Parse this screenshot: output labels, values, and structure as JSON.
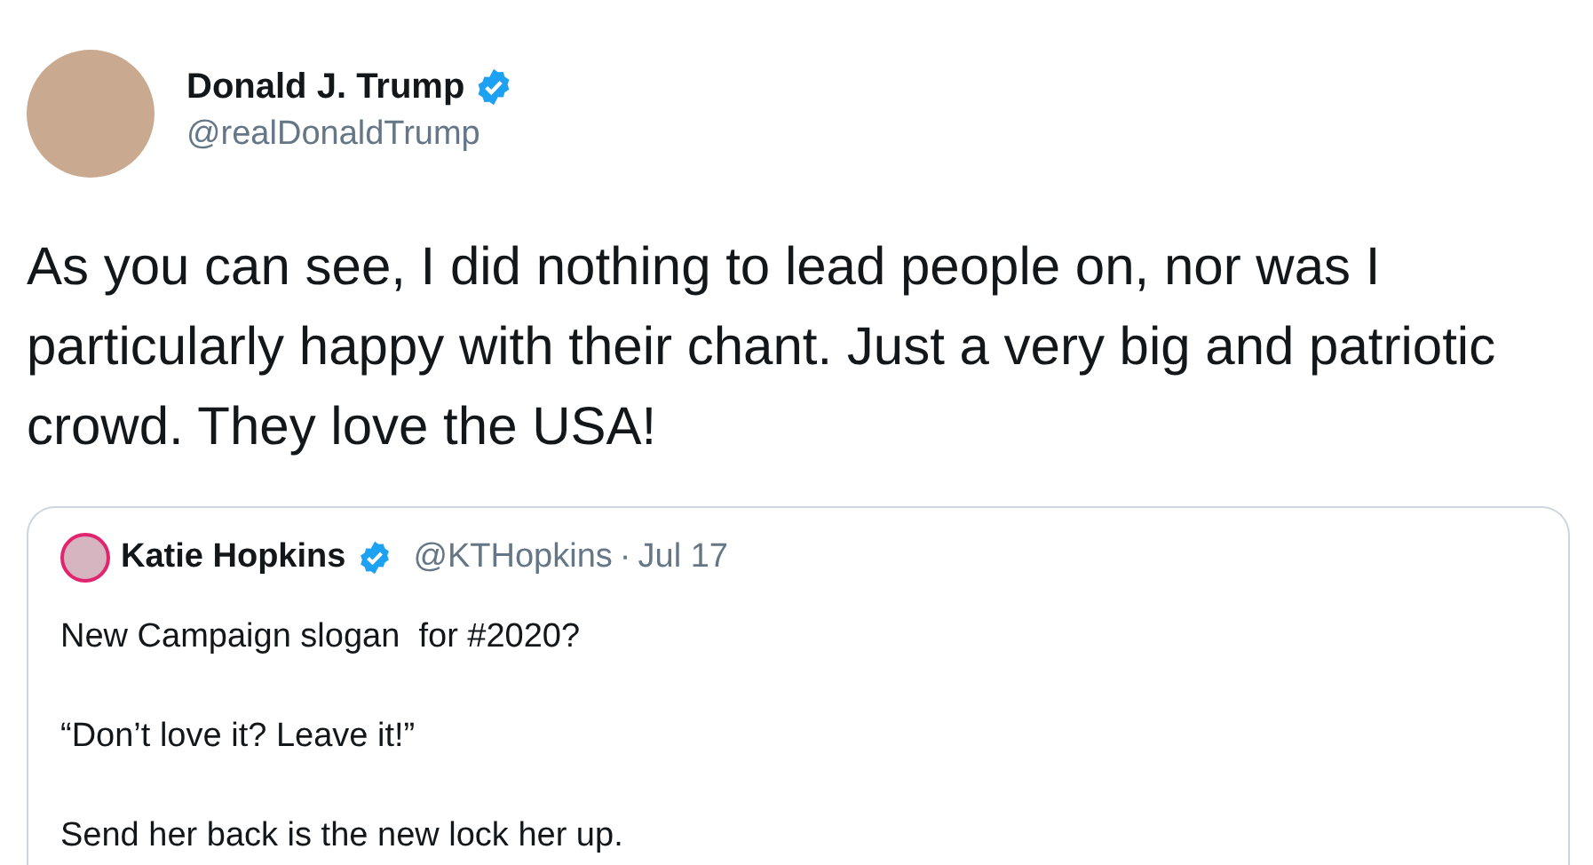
{
  "author": {
    "name": "Donald J. Trump",
    "verified": true,
    "handle": "@realDonaldTrump"
  },
  "text": "As you can see, I did nothing to lead people on, nor was I particularly happy with their chant. Just a very big and patriotic crowd. They love the USA!",
  "quoted_tweet": {
    "name": "Katie Hopkins",
    "verified": true,
    "handle": "@KTHopkins",
    "separator": "·",
    "date": "Jul 17",
    "paragraphs": [
      "New Campaign slogan  for #2020?",
      "“Don’t love it? Leave it!”",
      "Send her back is the new lock her up."
    ]
  }
}
